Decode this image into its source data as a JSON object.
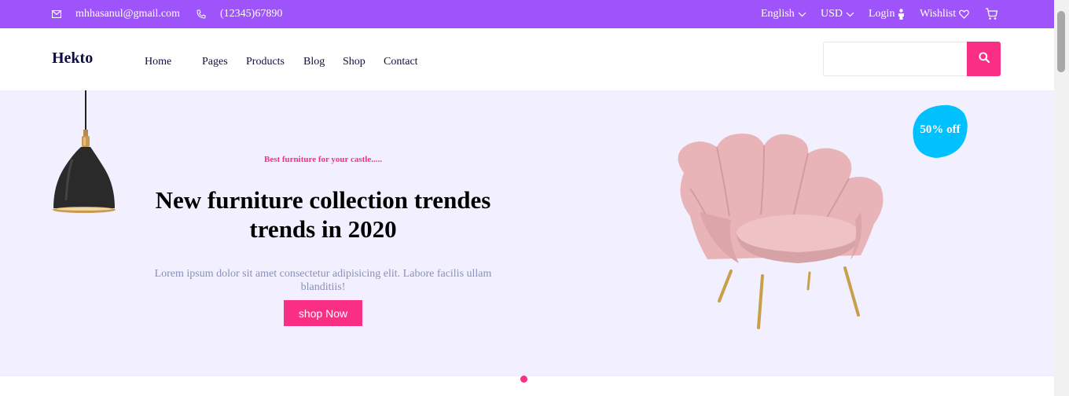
{
  "topbar": {
    "email": "mhhasanul@gmail.com",
    "phone": "(12345)67890",
    "language": "English",
    "currency": "USD",
    "login": "Login",
    "wishlist": "Wishlist"
  },
  "nav": {
    "logo": "Hekto",
    "links": [
      "Home",
      "Pages",
      "Products",
      "Blog",
      "Shop",
      "Contact"
    ],
    "search_placeholder": ""
  },
  "hero": {
    "tagline": "Best furniture for your castle.....",
    "headline_line1": "New furniture collection trendes",
    "headline_line2": "trends in 2020",
    "description": "Lorem ipsum dolor sit amet consectetur adipisicing elit. Labore facilis ullam blanditiis!",
    "cta": "shop Now",
    "badge": "50% off"
  },
  "colors": {
    "topbar": "#9f53fb",
    "accent": "#fb2e86",
    "hero_bg": "#f2f0ff",
    "badge": "#00c1fe"
  },
  "icons": [
    "mail-icon",
    "phone-icon",
    "chevron-down-icon",
    "user-icon",
    "heart-icon",
    "cart-icon",
    "search-icon"
  ]
}
